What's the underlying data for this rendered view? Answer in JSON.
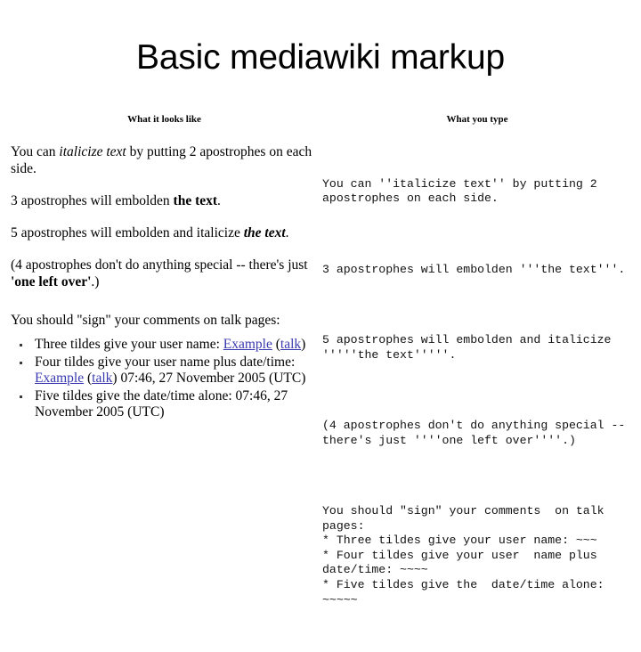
{
  "slide": {
    "title": "Basic mediawiki markup",
    "background_color": "#ffffff",
    "text_color": "#000000",
    "link_color": "#3a3ab0"
  },
  "columns": {
    "left": {
      "header": "What it looks like",
      "paragraphs": {
        "italic_line": {
          "pre": "You can ",
          "italic": "italicize text",
          "post": " by putting 2 apostrophes on each side."
        },
        "bold_line": {
          "pre": "3 apostrophes will embolden ",
          "bold": "the text",
          "post": "."
        },
        "bold_italic_line": {
          "pre": "5 apostrophes will embolden and italicize ",
          "bolditalic": "the text",
          "post": "."
        },
        "four_apostrophes_line": {
          "pre": "(4 apostrophes don't do anything special -- there's just ",
          "bold": "'one left over'",
          "post": ".)"
        },
        "sign_line": "You should \"sign\" your comments on talk pages:"
      },
      "bullets": {
        "three_tildes": {
          "pre": "Three tildes give your user name: ",
          "link_user": "Example",
          "mid_open": " (",
          "link_talk": "talk",
          "mid_close": ")"
        },
        "four_tildes": {
          "pre": "Four tildes give your user name plus date/time: ",
          "link_user": "Example",
          "mid_open": " (",
          "link_talk": "talk",
          "mid_close": ") ",
          "timestamp": "07:46, 27 November 2005 (UTC)"
        },
        "five_tildes": {
          "text": "Five tildes give the date/time alone: 07:46, 27 November 2005 (UTC)"
        }
      }
    },
    "right": {
      "header": "What you type",
      "blocks": {
        "italic_block": "You can ''italicize text'' by putting 2 apostrophes on each side.",
        "bold_block": "3 apostrophes will embolden '''the text'''.",
        "bold_italic_block": "5 apostrophes will embolden and italicize '''''the text'''''.",
        "four_apostrophes_block": "(4 apostrophes don't do anything special -- there's just ''''one left over''''.)",
        "sign_block": "You should \"sign\" your comments  on talk pages:\n* Three tildes give your user name: ~~~\n* Four tildes give your user  name plus date/time: ~~~~\n* Five tildes give the  date/time alone: ~~~~~"
      }
    }
  }
}
